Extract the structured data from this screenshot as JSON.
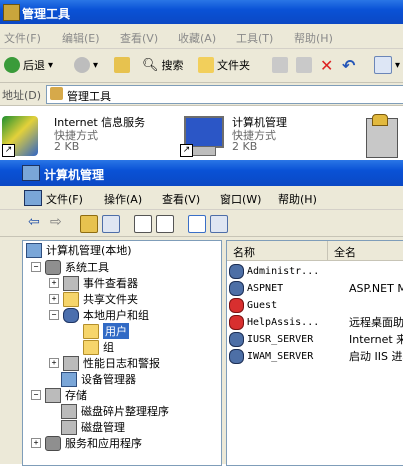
{
  "explorer": {
    "title": "管理工具",
    "menu": [
      "文件(F)",
      "编辑(E)",
      "查看(V)",
      "收藏(A)",
      "工具(T)",
      "帮助(H)"
    ],
    "toolbar": {
      "back": "后退",
      "search": "搜索",
      "folders": "文件夹"
    },
    "address_label": "地址(D)",
    "address_value": "管理工具",
    "items": [
      {
        "name": "Internet 信息服务",
        "type": "快捷方式",
        "size": "2 KB"
      },
      {
        "name": "计算机管理",
        "type": "快捷方式",
        "size": "2 KB"
      }
    ]
  },
  "mmc": {
    "title": "计算机管理",
    "menu": [
      "文件(F)",
      "操作(A)",
      "查看(V)",
      "窗口(W)",
      "帮助(H)"
    ],
    "tree": {
      "root": "计算机管理(本地)",
      "system_tools": "系统工具",
      "event_viewer": "事件查看器",
      "shared_folders": "共享文件夹",
      "local_users": "本地用户和组",
      "users": "用户",
      "groups": "组",
      "perf_logs": "性能日志和警报",
      "device_manager": "设备管理器",
      "storage": "存储",
      "defrag": "磁盘碎片整理程序",
      "disk_mgmt": "磁盘管理",
      "services_apps": "服务和应用程序"
    },
    "list": {
      "col_name": "名称",
      "col_fullname": "全名",
      "rows": [
        {
          "name": "Administr...",
          "full": "",
          "disabled": false
        },
        {
          "name": "ASPNET",
          "full": "ASP.NET Mach",
          "disabled": false
        },
        {
          "name": "Guest",
          "full": "",
          "disabled": true
        },
        {
          "name": "HelpAssis...",
          "full": "远程桌面助手",
          "disabled": true
        },
        {
          "name": "IUSR_SERVER",
          "full": "Internet 来宾",
          "disabled": false
        },
        {
          "name": "IWAM_SERVER",
          "full": "启动 IIS 进程",
          "disabled": false
        }
      ]
    }
  }
}
